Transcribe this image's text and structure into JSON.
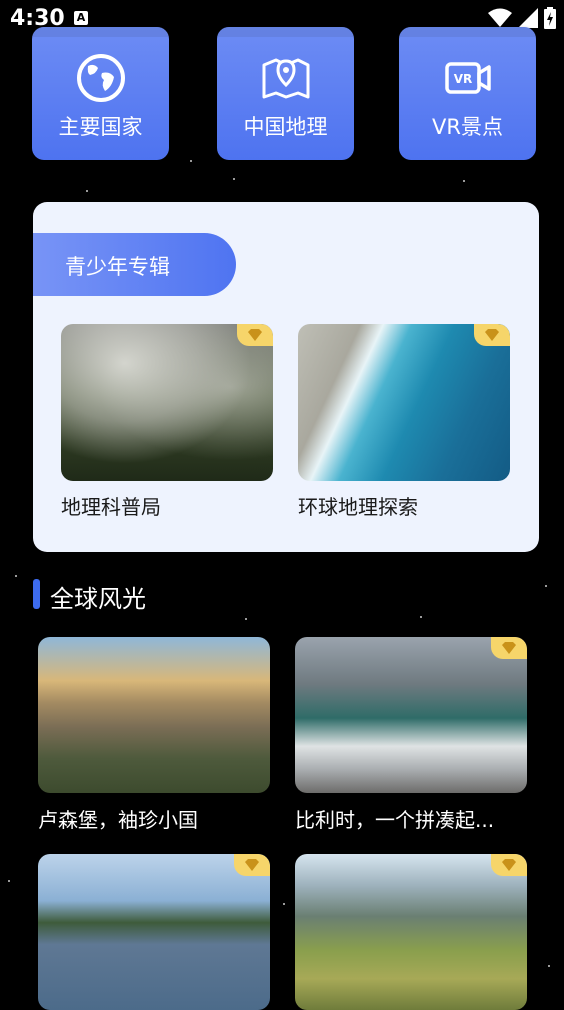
{
  "status_bar": {
    "time": "4:30",
    "notification_icon": "A"
  },
  "nav_tiles": [
    {
      "label": "主要国家",
      "icon": "globe-icon"
    },
    {
      "label": "中国地理",
      "icon": "map-pin-icon"
    },
    {
      "label": "VR景点",
      "icon": "vr-camera-icon"
    }
  ],
  "album": {
    "title": "青少年专辑",
    "items": [
      {
        "caption": "地理科普局",
        "image": "foggy-forest"
      },
      {
        "caption": "环球地理探索",
        "image": "ocean-wave"
      }
    ]
  },
  "section": {
    "title": "全球风光"
  },
  "scenery": [
    {
      "caption": "卢森堡，袖珍小国",
      "image": "luxembourg-city"
    },
    {
      "caption": "比利时，一个拼凑起...",
      "image": "belgium-statue"
    },
    {
      "caption": "",
      "image": "lake-castle"
    },
    {
      "caption": "",
      "image": "mountain-valley"
    }
  ],
  "colors": {
    "accent": "#4e73f0",
    "card_bg": "#eef3fe",
    "badge": "#f6d56a"
  }
}
